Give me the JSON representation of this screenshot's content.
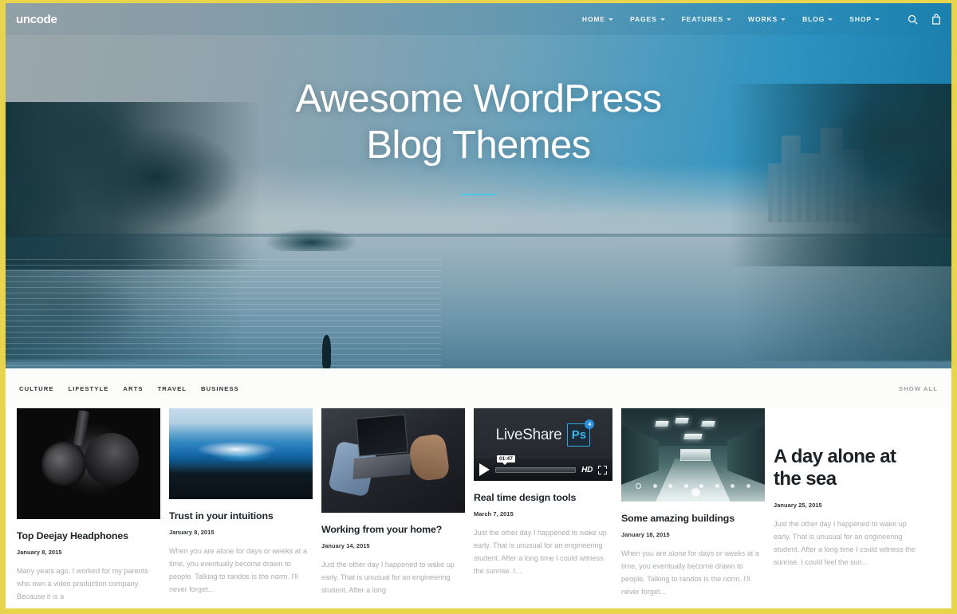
{
  "site": {
    "logo": "uncode",
    "accent_color": "#49c8e8",
    "frame_color": "#e8d44d"
  },
  "nav": {
    "items": [
      {
        "label": "HOME",
        "has_dropdown": true
      },
      {
        "label": "PAGES",
        "has_dropdown": true
      },
      {
        "label": "FEATURES",
        "has_dropdown": true
      },
      {
        "label": "WORKS",
        "has_dropdown": true
      },
      {
        "label": "BLOG",
        "has_dropdown": true
      },
      {
        "label": "SHOP",
        "has_dropdown": true
      }
    ],
    "search_icon": "search-icon",
    "cart_icon": "cart-icon"
  },
  "hero": {
    "title_line1": "Awesome WordPress",
    "title_line2": "Blog Themes"
  },
  "filterbar": {
    "categories": [
      "CULTURE",
      "LIFESTYLE",
      "ARTS",
      "TRAVEL",
      "BUSINESS"
    ],
    "show_all": "SHOW ALL"
  },
  "posts": [
    {
      "title": "Top Deejay Headphones",
      "date": "January 8, 2015",
      "excerpt": "Many years ago, I worked for my parents who own a video production company. Because it is a",
      "media": "headphones-photo"
    },
    {
      "title": "Trust in your intuitions",
      "date": "January 8, 2015",
      "excerpt": "When you are alone for days or weeks at a time, you eventually become drawn to people. Talking to randos is the norm. I'll never forget...",
      "media": "ocean-wave-photo"
    },
    {
      "title": "Working from your home?",
      "date": "January 14, 2015",
      "excerpt": "Just the other day I happened to wake up early. That is unusual for an engineering student. After a long",
      "media": "laptop-photo"
    },
    {
      "title": "Real time design tools",
      "date": "March 7, 2015",
      "excerpt": "Just the other day I happened to wake up early. That is unusual for an engineering student. After a long time I could witness the sunrise. I...",
      "media": "video-player",
      "video": {
        "brand": "LiveShare",
        "app_badge": "Ps",
        "badge_count": "4",
        "timestamp": "01:47",
        "quality": "HD"
      }
    },
    {
      "title": "Some amazing buildings",
      "date": "January 18, 2015",
      "excerpt": "When you are alone for days or weeks at a time, you eventually become drawn to people. Talking to randos is the norm. I'll never forget...",
      "media": "building-interior-photo"
    },
    {
      "title": "A day alone at the sea",
      "date": "January 25, 2015",
      "excerpt": "Just the other day I happened to wake up early. That is unusual for an engineering student. After a long time I could witness the sunrise. I could feel the sun...",
      "media": "none"
    }
  ]
}
